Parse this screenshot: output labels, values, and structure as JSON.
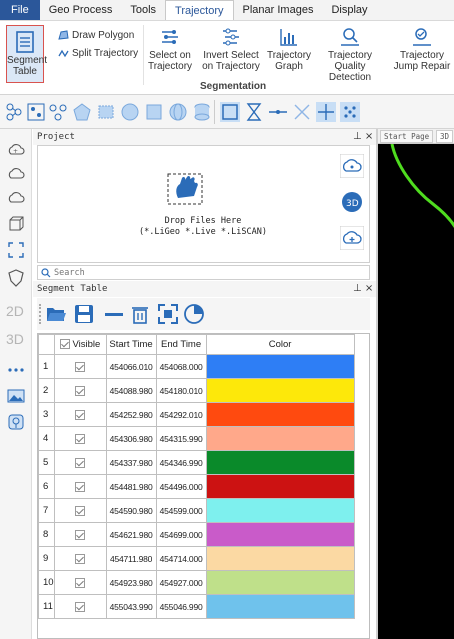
{
  "menu": {
    "file": "File",
    "items": [
      "Geo Process",
      "Tools",
      "Trajectory",
      "Planar Images",
      "Display"
    ],
    "active": "Trajectory"
  },
  "ribbon": {
    "segment_table": "Segment Table",
    "draw_polygon": "Draw Polygon",
    "split_trajectory": "Split Trajectory",
    "buttons": [
      {
        "label": "Select on Trajectory",
        "icon": "select-trajectory-icon"
      },
      {
        "label": "Invert Select on Trajectory",
        "icon": "invert-select-icon"
      },
      {
        "label": "Trajectory Graph",
        "icon": "graph-icon"
      },
      {
        "label": "Trajectory Quality Detection",
        "icon": "quality-detection-icon"
      },
      {
        "label": "Trajectory Jump Repair",
        "icon": "jump-repair-icon"
      }
    ],
    "group_label": "Segmentation"
  },
  "project_panel": {
    "title": "Project",
    "pin": "⊥ ×",
    "drop_line1": "Drop Files Here",
    "drop_line2": "(*.LiGeo *.Live *.LiSCAN)"
  },
  "search": {
    "placeholder": "Search"
  },
  "left_strip": {
    "label_2d": "2D",
    "label_3d": "3D"
  },
  "segment_panel": {
    "title": "Segment Table",
    "pin": "⊥ ×"
  },
  "table": {
    "headers": [
      "",
      "Visible",
      "Start Time",
      "End Time",
      "Color"
    ],
    "rows": [
      {
        "n": "1",
        "start": "454066.010",
        "end": "454068.000",
        "color": "#2e7ef5"
      },
      {
        "n": "2",
        "start": "454088.980",
        "end": "454180.010",
        "color": "#fde80a"
      },
      {
        "n": "3",
        "start": "454252.980",
        "end": "454292.010",
        "color": "#ff4a0f"
      },
      {
        "n": "4",
        "start": "454306.980",
        "end": "454315.990",
        "color": "#ffa88a"
      },
      {
        "n": "5",
        "start": "454337.980",
        "end": "454346.990",
        "color": "#0a8a2a"
      },
      {
        "n": "6",
        "start": "454481.980",
        "end": "454496.000",
        "color": "#cc1212"
      },
      {
        "n": "7",
        "start": "454590.980",
        "end": "454599.000",
        "color": "#7ef0ee"
      },
      {
        "n": "8",
        "start": "454621.980",
        "end": "454699.000",
        "color": "#c95bc9"
      },
      {
        "n": "9",
        "start": "454711.980",
        "end": "454714.000",
        "color": "#fbd9a3"
      },
      {
        "n": "10",
        "start": "454923.980",
        "end": "454927.000",
        "color": "#bfe08a"
      },
      {
        "n": "11",
        "start": "455043.990",
        "end": "455046.990",
        "color": "#6fc2ec"
      }
    ]
  },
  "view": {
    "tabs": [
      "Start Page",
      "3D"
    ]
  },
  "colors": {
    "accent": "#2b579a",
    "view_bg": "#000000",
    "trajectory": "#4fdc1f"
  }
}
